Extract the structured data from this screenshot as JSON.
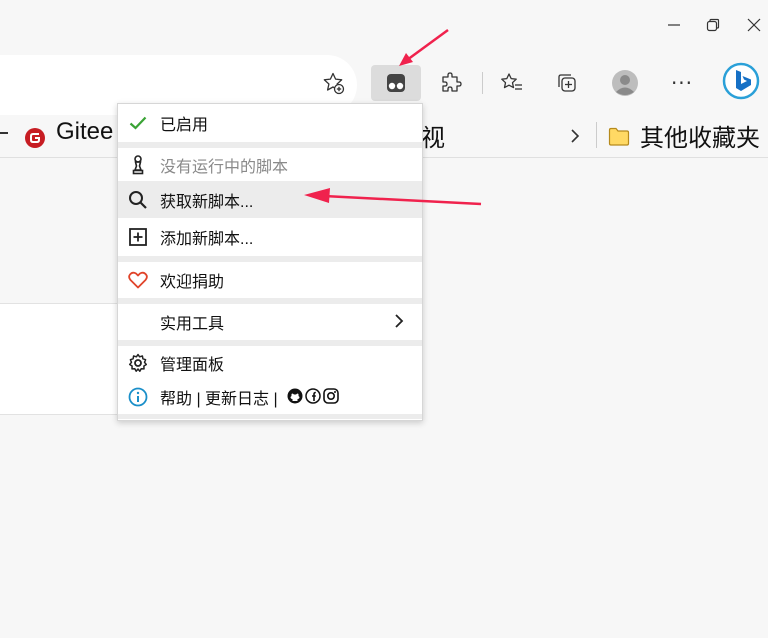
{
  "bookmarks": {
    "gitee_label": "Gitee",
    "partial_label": "视",
    "other_folder_label": "其他收藏夹"
  },
  "menu": {
    "enabled_label": "已启用",
    "no_scripts_label": "没有运行中的脚本",
    "get_new_label": "获取新脚本...",
    "add_new_label": "添加新脚本...",
    "donate_label": "欢迎捐助",
    "utilities_label": "实用工具",
    "dashboard_label": "管理面板",
    "help_label": "帮助 | 更新日志 |"
  },
  "colors": {
    "accent_red": "#f0224d",
    "check_green": "#3aa335",
    "heart_red": "#e0442a",
    "info_blue": "#1a8fc9",
    "hover_bg": "#ececec"
  }
}
